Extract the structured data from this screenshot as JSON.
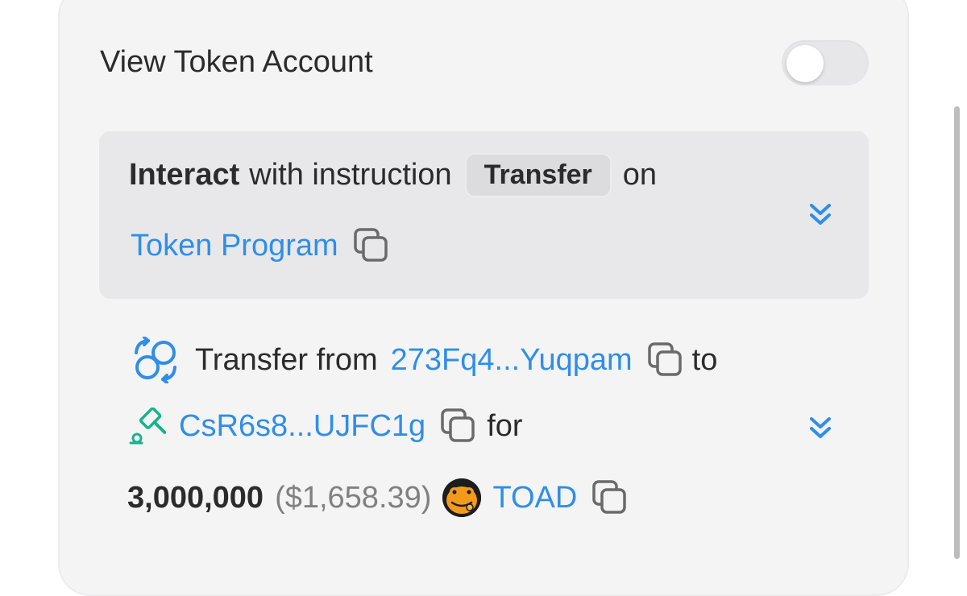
{
  "header": {
    "title": "View Token Account",
    "toggle_on": false
  },
  "interact": {
    "prefix_bold": "Interact",
    "prefix_rest": "with instruction",
    "instruction": "Transfer",
    "suffix": "on",
    "program": "Token Program"
  },
  "transfer": {
    "label": "Transfer from",
    "from": "273Fq4...Yuqpam",
    "to_word": "to",
    "to": "CsR6s8...UJFC1g",
    "for_word": "for",
    "amount": "3,000,000",
    "usd": "($1,658.39)",
    "token": "TOAD"
  },
  "colors": {
    "link": "#2f8ee8",
    "accent_green": "#17b38a"
  }
}
